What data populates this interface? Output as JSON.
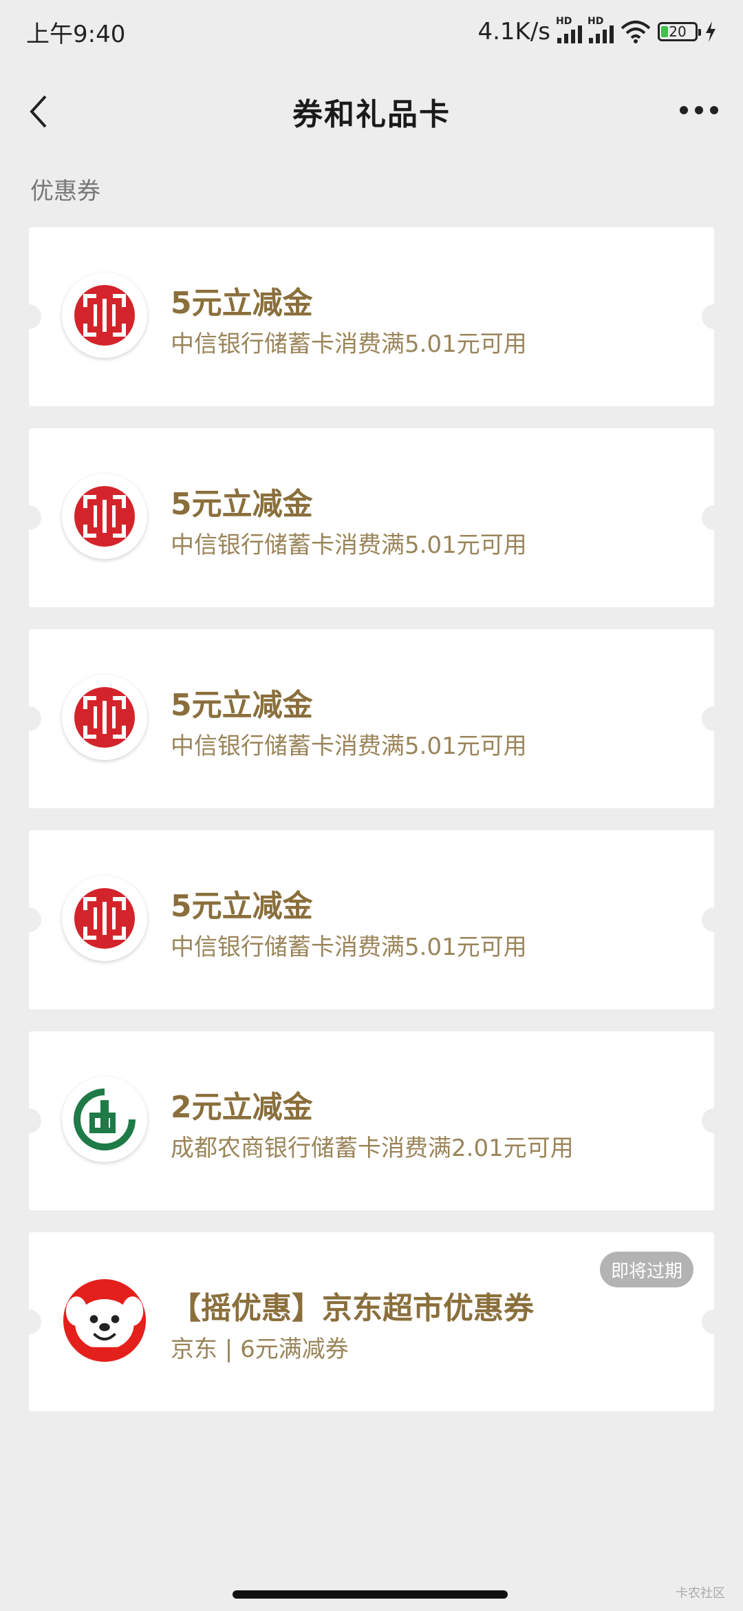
{
  "status_bar": {
    "time": "上午9:40",
    "net_speed": "4.1K/s",
    "signal_label": "HD",
    "battery": "20"
  },
  "nav": {
    "title": "券和礼品卡"
  },
  "section_label": "优惠券",
  "coupons": [
    {
      "title": "5元立减金",
      "desc": "中信银行储蓄卡消费满5.01元可用",
      "logo": "citic-bank-icon"
    },
    {
      "title": "5元立减金",
      "desc": "中信银行储蓄卡消费满5.01元可用",
      "logo": "citic-bank-icon"
    },
    {
      "title": "5元立减金",
      "desc": "中信银行储蓄卡消费满5.01元可用",
      "logo": "citic-bank-icon"
    },
    {
      "title": "5元立减金",
      "desc": "中信银行储蓄卡消费满5.01元可用",
      "logo": "citic-bank-icon"
    },
    {
      "title": "2元立减金",
      "desc": "成都农商银行储蓄卡消费满2.01元可用",
      "logo": "chengdu-rural-bank-icon"
    },
    {
      "title": "【摇优惠】京东超市优惠券",
      "desc": "京东 | 6元满减券",
      "logo": "jd-dog-icon",
      "badge": "即将过期"
    }
  ],
  "colors": {
    "accent_gold": "#8a6f3c",
    "citic_red": "#d3242b",
    "rural_green": "#1e7a46",
    "jd_red": "#e4201c"
  },
  "watermark": "卡农社区"
}
